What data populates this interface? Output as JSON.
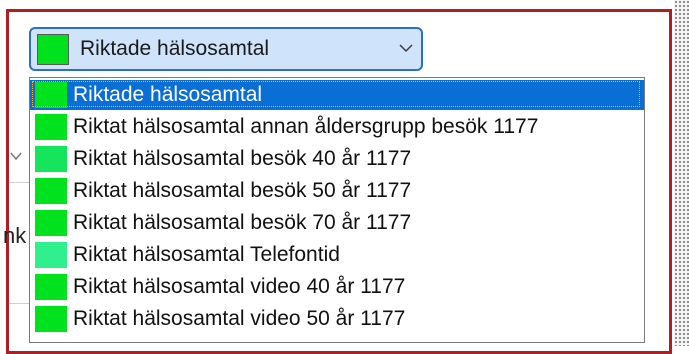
{
  "combo": {
    "selected_label": "Riktade hälsosamtal",
    "selected_color": "#00e21e",
    "chevron_icon": "chevron-down-icon"
  },
  "background": {
    "partial_text": "nk",
    "partial_icon": "chevron-down-icon"
  },
  "dropdown": {
    "items": [
      {
        "label": "Riktade hälsosamtal",
        "color": "#00e21e",
        "selected": true
      },
      {
        "label": "Riktat hälsosamtal annan åldersgrupp besök 1177",
        "color": "#00e21e",
        "selected": false
      },
      {
        "label": "Riktat hälsosamtal besök 40 år 1177",
        "color": "#15e55a",
        "selected": false
      },
      {
        "label": "Riktat hälsosamtal besök 50 år 1177",
        "color": "#00e21e",
        "selected": false
      },
      {
        "label": "Riktat hälsosamtal besök 70 år 1177",
        "color": "#00e21e",
        "selected": false
      },
      {
        "label": "Riktat hälsosamtal Telefontid",
        "color": "#2ff08c",
        "selected": false
      },
      {
        "label": "Riktat hälsosamtal video 40 år 1177",
        "color": "#00e21e",
        "selected": false
      },
      {
        "label": "Riktat hälsosamtal video 50 år 1177",
        "color": "#00e21e",
        "selected": false
      }
    ]
  }
}
